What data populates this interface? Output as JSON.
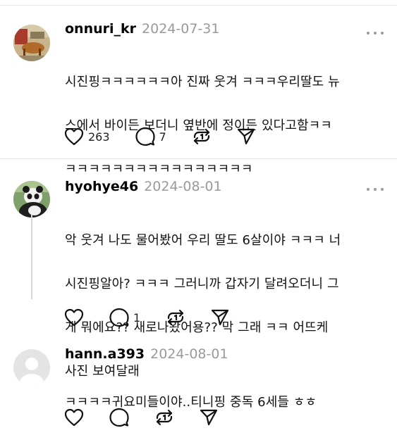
{
  "posts": [
    {
      "username": "onnuri_kr",
      "date": "2024-07-31",
      "lines": [
        "시진핑ㅋㅋㅋㅋㅋㅋ아 진짜 웃겨 ㅋㅋㅋ우리딸도 뉴",
        "스에서 바이든 보더니 옆반에 정이든 있다고함ㅋㅋ",
        "ㅋㅋㅋㅋㅋㅋㅋㅋㅋㅋㅋㅋㅋㅋㅋㅋ"
      ],
      "likes": "263",
      "replies": "7"
    },
    {
      "username": "hyohye46",
      "date": "2024-08-01",
      "lines": [
        "악 웃겨 나도 물어봤어 우리 딸도 6살이야 ㅋㅋㅋ 너",
        "시진핑알아? ㅋㅋㅋ 그러니까 갑자기 달려오더니 그",
        "게 뭐에요?? 새로나왔어용?? 막 그래 ㅋㅋ 어뜨케",
        "사진 보여달래"
      ],
      "likes": "",
      "replies": "1"
    },
    {
      "username": "hann.a393",
      "date": "2024-08-01",
      "lines": [
        "ㅋㅋㅋㅋ귀요미들이야..티니핑 중독 6세들 ㅎㅎ"
      ],
      "likes": "",
      "replies": ""
    }
  ],
  "icons": {
    "like": "heart-icon",
    "reply": "comment-icon",
    "repost": "repost-icon",
    "share": "send-icon",
    "more": "more-icon"
  }
}
